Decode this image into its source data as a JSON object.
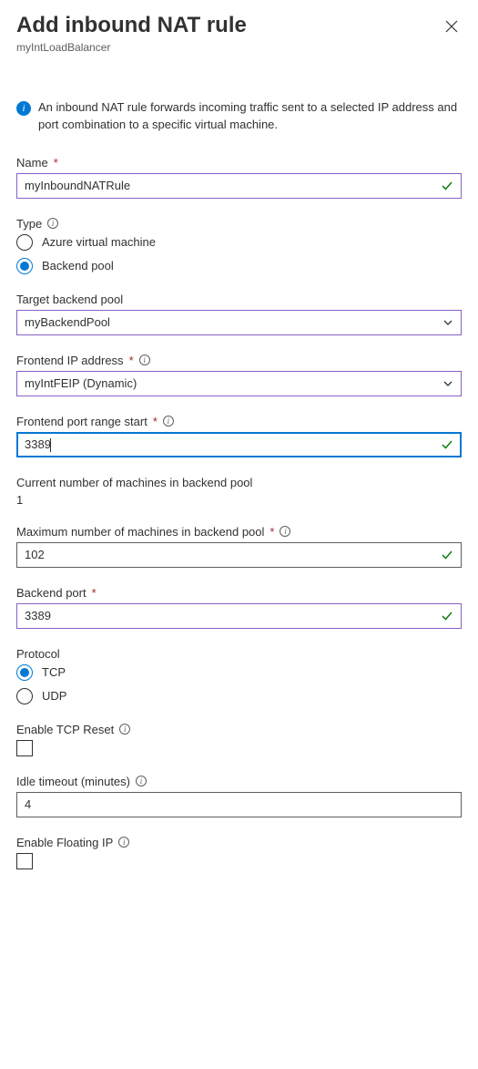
{
  "header": {
    "title": "Add inbound NAT rule",
    "subtitle": "myIntLoadBalancer"
  },
  "info": {
    "text": "An inbound NAT rule forwards incoming traffic sent to a selected IP address and port combination to a specific virtual machine."
  },
  "fields": {
    "name": {
      "label": "Name",
      "value": "myInboundNATRule"
    },
    "type": {
      "label": "Type",
      "option_vm": "Azure virtual machine",
      "option_pool": "Backend pool"
    },
    "targetPool": {
      "label": "Target backend pool",
      "value": "myBackendPool"
    },
    "frontendIp": {
      "label": "Frontend IP address",
      "value": "myIntFEIP (Dynamic)"
    },
    "frontendPortStart": {
      "label": "Frontend port range start",
      "value": "3389"
    },
    "currentMachines": {
      "label": "Current number of machines in backend pool",
      "value": "1"
    },
    "maxMachines": {
      "label": "Maximum number of machines in backend pool",
      "value": "102"
    },
    "backendPort": {
      "label": "Backend port",
      "value": "3389"
    },
    "protocol": {
      "label": "Protocol",
      "option_tcp": "TCP",
      "option_udp": "UDP"
    },
    "tcpReset": {
      "label": "Enable TCP Reset"
    },
    "idleTimeout": {
      "label": "Idle timeout (minutes)",
      "value": "4"
    },
    "floatingIp": {
      "label": "Enable Floating IP"
    }
  }
}
